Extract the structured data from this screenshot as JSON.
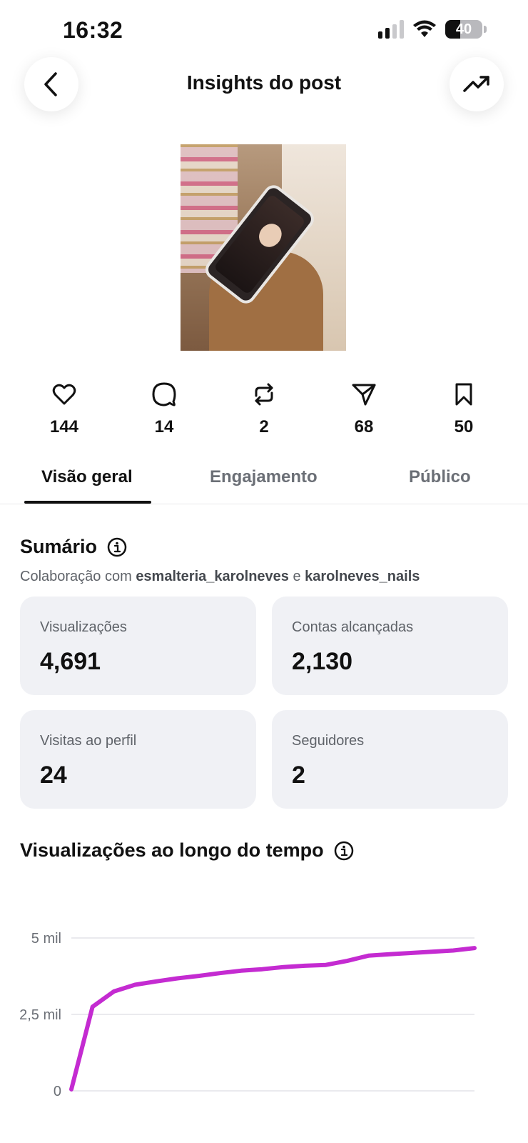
{
  "status_bar": {
    "time": "16:32",
    "battery": "40"
  },
  "header": {
    "title": "Insights do post"
  },
  "metrics": [
    {
      "icon": "heart-icon",
      "value": "144"
    },
    {
      "icon": "comment-icon",
      "value": "14"
    },
    {
      "icon": "repost-icon",
      "value": "2"
    },
    {
      "icon": "share-icon",
      "value": "68"
    },
    {
      "icon": "bookmark-icon",
      "value": "50"
    }
  ],
  "tabs": [
    {
      "label": "Visão geral",
      "active": true
    },
    {
      "label": "Engajamento",
      "active": false
    },
    {
      "label": "Público",
      "active": false
    }
  ],
  "summary": {
    "title": "Sumário",
    "collab_prefix": "Colaboração com",
    "collab_user1": "esmalteria_karolneves",
    "collab_joiner": "e",
    "collab_user2": "karolneves_nails",
    "cards": [
      {
        "label": "Visualizações",
        "value": "4,691"
      },
      {
        "label": "Contas alcançadas",
        "value": "2,130"
      },
      {
        "label": "Visitas ao perfil",
        "value": "24"
      },
      {
        "label": "Seguidores",
        "value": "2"
      }
    ]
  },
  "chart_section": {
    "title": "Visualizações ao longo do tempo"
  },
  "chart_data": {
    "type": "line",
    "title": "Visualizações ao longo do tempo",
    "y_ticks": [
      {
        "value": 5000,
        "label": "5 mil"
      },
      {
        "value": 2500,
        "label": "2,5 mil"
      },
      {
        "value": 0,
        "label": "0"
      }
    ],
    "ylim": [
      0,
      5000
    ],
    "x": [
      0,
      1,
      2,
      3,
      4,
      5,
      6,
      7,
      8,
      9,
      10,
      11,
      12,
      13,
      14,
      15,
      16,
      17,
      18,
      19
    ],
    "series": [
      {
        "values": [
          50,
          2750,
          3250,
          3470,
          3580,
          3680,
          3760,
          3850,
          3930,
          3980,
          4050,
          4090,
          4120,
          4250,
          4420,
          4470,
          4510,
          4550,
          4590,
          4670
        ]
      }
    ],
    "grid": true,
    "color": "#c42bd1"
  }
}
